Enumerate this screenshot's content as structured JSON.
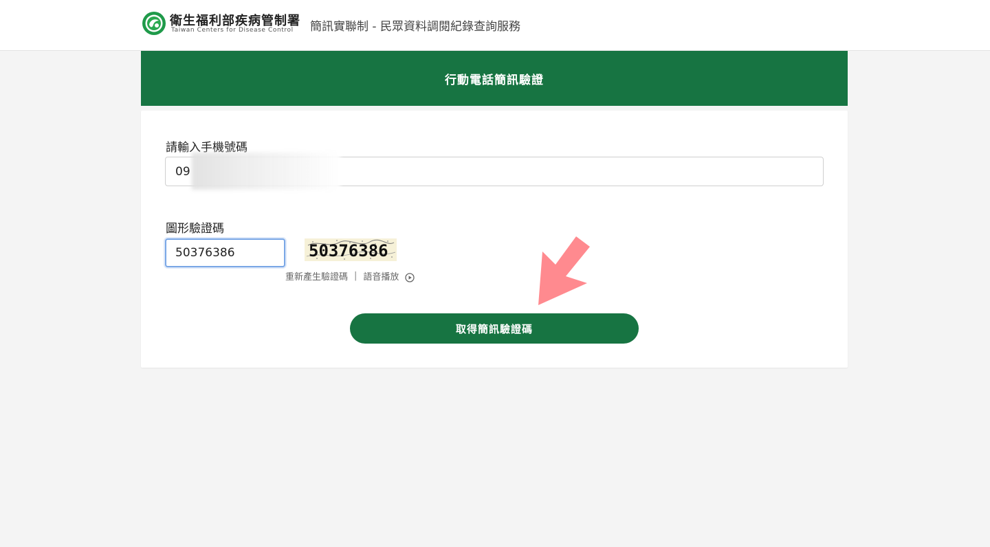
{
  "header": {
    "org_name": "衛生福利部疾病管制署",
    "org_name_en": "Taiwan Centers for Disease Control",
    "service_title": "簡訊實聯制 - 民眾資料調閱紀錄查詢服務"
  },
  "card": {
    "title": "行動電話簡訊驗證"
  },
  "form": {
    "phone_label": "請輸入手機號碼",
    "phone_value": "09",
    "captcha_label": "圖形驗證碼",
    "captcha_value": "50376386",
    "captcha_image_text": "50376386",
    "regenerate_link": "重新產生驗證碼",
    "separator": "|",
    "audio_link": "語音播放",
    "submit_label": "取得簡訊驗證碼"
  },
  "icons": {
    "logo": "cdc-logo-icon",
    "play": "play-circle-icon",
    "annotation_arrow": "arrow-down-left-icon"
  },
  "colors": {
    "primary_green": "#177442",
    "focus_blue": "#7aa7e6",
    "arrow_pink": "#ff8a8f"
  }
}
